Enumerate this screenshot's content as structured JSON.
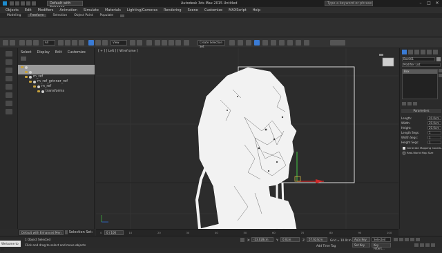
{
  "titlebar": {
    "workspace": "Default with Enhance",
    "app_title": "Autodesk 3ds Max 2015  Untitled",
    "search_placeholder": "Type a keyword or phrase",
    "minimize": "–",
    "maximize": "□",
    "close": "✕"
  },
  "menu": [
    "Objects",
    "Edit",
    "Modifiers",
    "Animation",
    "Simulate",
    "Materials",
    "Lighting/Cameras",
    "Rendering",
    "Scene",
    "Customize",
    "MAXScript",
    "Help"
  ],
  "ribbon_tabs": [
    "Modeling",
    "Freeform",
    "Selection",
    "Object Paint",
    "Populate"
  ],
  "ribbon_active": "Freeform",
  "toolbar": {
    "selection_filter": "All",
    "view_field": "View",
    "named_selection": "Create Selection Set"
  },
  "scene_explorer": {
    "tabs": [
      "Select",
      "Display",
      "Edit",
      "Customize"
    ],
    "rows": [
      {
        "label": "",
        "indent": 0,
        "selected": true
      },
      {
        "label": "",
        "indent": 1,
        "selected": true
      },
      {
        "label": "m_ref",
        "indent": 1,
        "selected": false
      },
      {
        "label": "m_ref_grinner_ref",
        "indent": 2,
        "selected": false
      },
      {
        "label": "m_ref",
        "indent": 3,
        "selected": false
      },
      {
        "label": "transforms",
        "indent": 4,
        "selected": false
      }
    ],
    "layer_dropdown": "Default with Enhanced Men",
    "selection_set_label": "Selection Set:"
  },
  "viewport": {
    "label": "[ + ] [ Left ] [ Wireframe ]"
  },
  "command_panel": {
    "object_name": "Box001",
    "modifier_list": "Modifier List",
    "stack_item": "Box",
    "parameters_header": "Parameters",
    "params": [
      {
        "label": "Length:",
        "value": "20.0cm"
      },
      {
        "label": "Width:",
        "value": "20.0cm"
      },
      {
        "label": "Height:",
        "value": "20.0cm"
      },
      {
        "label": "Length Segs:",
        "value": "1"
      },
      {
        "label": "Width Segs:",
        "value": "1"
      },
      {
        "label": "Height Segs:",
        "value": "1"
      }
    ],
    "checkbox_mapping": "Generate Mapping Coords.",
    "checkbox_realworld": "Real-World Map Size"
  },
  "timeline": {
    "frame_counter": "0 / 100",
    "ticks": [
      "0",
      "10",
      "20",
      "30",
      "40",
      "50",
      "60",
      "70",
      "80",
      "90",
      "100"
    ]
  },
  "status": {
    "objects_selected": "1 Object Selected",
    "prompt": "Click and drag to select and move objects",
    "maxscript": "Welcome to M",
    "x_label": "X:",
    "x_value": "-23.028cm",
    "y_label": "Y:",
    "y_value": "0.0cm",
    "z_label": "Z:",
    "z_value": "57.624cm",
    "grid": "Grid = 10.0cm",
    "add_time_tag": "Add Time Tag",
    "auto_key": "Auto Key",
    "set_key": "Set Key",
    "selected": "Selected",
    "key_filters": "Key Filters..."
  },
  "colors": {
    "accent_blue": "#3a7bd5",
    "selection_grey": "#9a9a9a",
    "gizmo_green": "#3fae3f",
    "gizmo_red": "#d02a2a",
    "gizmo_blue": "#2f6fd8",
    "wire_white": "#f2f2f2"
  }
}
